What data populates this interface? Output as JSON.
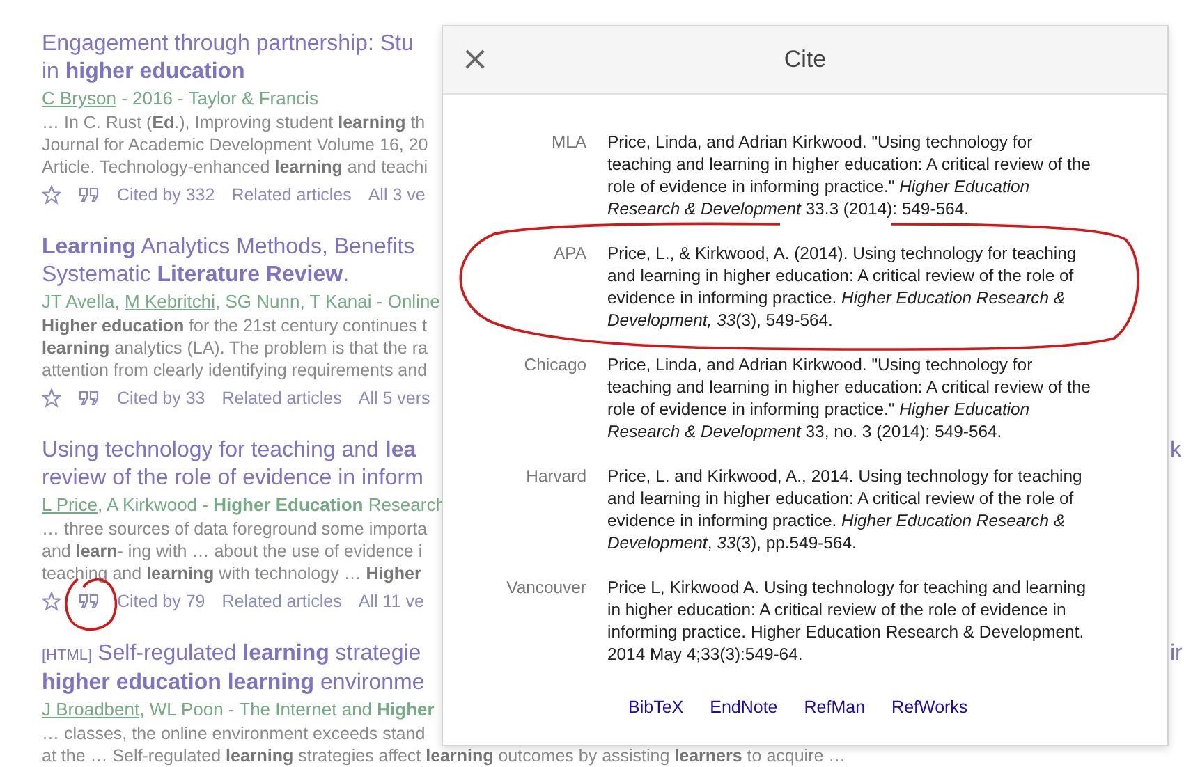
{
  "results": [
    {
      "title_lines": [
        "Engagement through partnership: Stu",
        "in **higher education**"
      ],
      "author_line": [
        {
          "text": "C Bryson",
          "link": true
        },
        {
          "text": " - 2016 - Taylor & Francis",
          "link": false
        }
      ],
      "snippet_lines": [
        "… In C. Rust (**Ed**.), Improving student **learning** th",
        "Journal for Academic Development Volume 16, 20",
        "Article. Technology-enhanced **learning** and teachi"
      ],
      "actions": [
        "Cited by 332",
        "Related articles",
        "All 3 ve"
      ]
    },
    {
      "title_lines": [
        "**Learning** Analytics Methods, Benefits",
        "Systematic **Literature Review**."
      ],
      "author_line": [
        {
          "text": "JT Avella, ",
          "link": false
        },
        {
          "text": "M Kebritchi",
          "link": true
        },
        {
          "text": ", SG Nunn, T Kanai - Online",
          "link": false
        }
      ],
      "snippet_lines": [
        "**Higher education** for the 21st century continues t",
        "**learning** analytics (LA). The problem is that the ra",
        "attention from clearly identifying requirements and"
      ],
      "actions": [
        "Cited by 33",
        "Related articles",
        "All 5 vers"
      ]
    },
    {
      "title_lines": [
        "Using technology for teaching and **lea**",
        "review of the role of evidence in inform"
      ],
      "title_overflow": "k",
      "author_line": [
        {
          "text": "L Price",
          "link": true
        },
        {
          "text": ", A Kirkwood - **Higher Education** Research",
          "link": false
        }
      ],
      "snippet_lines": [
        "… three sources of data foreground some importa",
        "and **learn**- ing with … about the use of evidence i",
        "teaching and **learning** with technology … **Higher**"
      ],
      "actions": [
        "Cited by 79",
        "Related articles",
        "All 11 ve"
      ]
    },
    {
      "tag": "[HTML]",
      "title_lines": [
        "Self-regulated **learning** strategie",
        "**higher education learning** environme"
      ],
      "title_overflow": "ir",
      "author_line": [
        {
          "text": "J Broadbent",
          "link": true
        },
        {
          "text": ", WL Poon - The Internet and **Higher**",
          "link": false
        }
      ],
      "snippet_lines": [
        "… classes, the online environment exceeds stand",
        "at the … Self-regulated **learning** strategies affect **learning** outcomes by assisting **learners** to acquire …"
      ]
    }
  ],
  "dialog": {
    "close": "×",
    "title": "Cite",
    "citations": [
      {
        "style": "MLA",
        "text": "Price, Linda, and Adrian Kirkwood. \"Using technology for teaching and learning in higher education: A critical review of the role of evidence in informing practice.\" *Higher Education Research & Development* 33.3 (2014): 549-564."
      },
      {
        "style": "APA",
        "text": "Price, L., & Kirkwood, A. (2014). Using technology for teaching and learning in higher education: A critical review of the role of evidence in informing practice. *Higher Education Research & Development, 33*(3), 549-564."
      },
      {
        "style": "Chicago",
        "text": "Price, Linda, and Adrian Kirkwood. \"Using technology for teaching and learning in higher education: A critical review of the role of evidence in informing practice.\" *Higher Education Research & Development* 33, no. 3 (2014): 549-564."
      },
      {
        "style": "Harvard",
        "text": "Price, L. and Kirkwood, A., 2014. Using technology for teaching and learning in higher education: A critical review of the role of evidence in informing practice. *Higher Education Research & Development*, *33*(3), pp.549-564."
      },
      {
        "style": "Vancouver",
        "text": "Price L, Kirkwood A. Using technology for teaching and learning in higher education: A critical review of the role of evidence in informing practice. Higher Education Research & Development. 2014 May 4;33(3):549-64."
      }
    ],
    "export_links": [
      "BibTeX",
      "EndNote",
      "RefMan",
      "RefWorks"
    ]
  }
}
